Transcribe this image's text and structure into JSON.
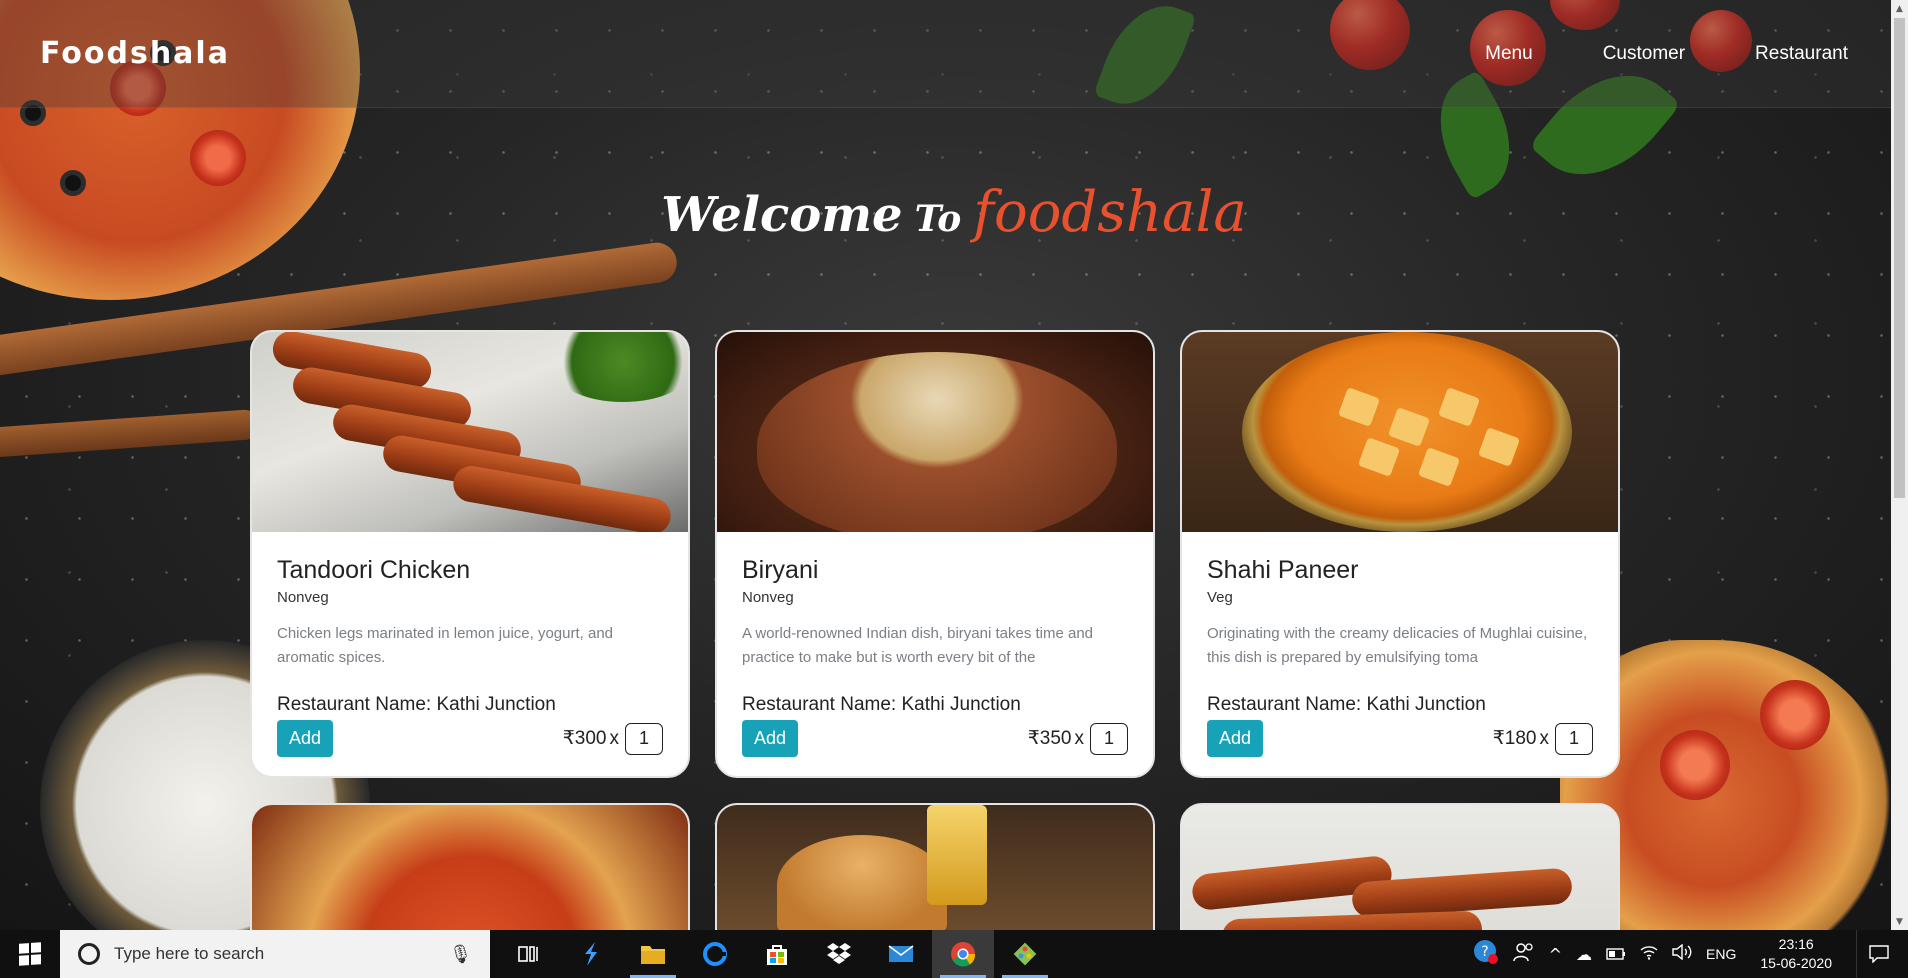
{
  "navbar": {
    "brand": "Foodshala",
    "links": [
      "Menu",
      "Customer",
      "Restaurant"
    ]
  },
  "hero": {
    "welcome": "Welcome",
    "to": "To",
    "brand": "foodshala"
  },
  "cards": [
    {
      "title": "Tandoori Chicken",
      "type": "Nonveg",
      "description": "Chicken legs marinated in lemon juice, yogurt, and aromatic spices.",
      "restaurant": "Restaurant Name: Kathi Junction",
      "add_label": "Add",
      "price": "₹300",
      "times": "x",
      "quantity": "1"
    },
    {
      "title": "Biryani",
      "type": "Nonveg",
      "description": "A world-renowned Indian dish, biryani takes time and practice to make but is worth every bit of the",
      "restaurant": "Restaurant Name: Kathi Junction",
      "add_label": "Add",
      "price": "₹350",
      "times": "x",
      "quantity": "1"
    },
    {
      "title": "Shahi Paneer",
      "type": "Veg",
      "description": "Originating with the creamy delicacies of Mughlai cuisine, this dish is prepared by emulsifying toma",
      "restaurant": "Restaurant Name: Kathi Junction",
      "add_label": "Add",
      "price": "₹180",
      "times": "x",
      "quantity": "1"
    }
  ],
  "taskbar": {
    "search_placeholder": "Type here to search",
    "apps": [
      "task-view",
      "visual-studio",
      "file-explorer",
      "edge",
      "store",
      "dropbox",
      "mail",
      "chrome",
      "git"
    ],
    "language": "ENG",
    "time": "23:16",
    "date": "15-06-2020"
  },
  "colors": {
    "accent_button": "#17a2b8",
    "brand_red": "#e9512e"
  }
}
